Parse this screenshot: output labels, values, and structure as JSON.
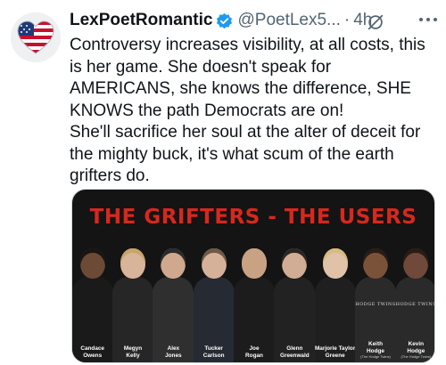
{
  "tweet": {
    "display_name": "LexPoetRomantic",
    "handle": "@PoetLex5...",
    "separator": "·",
    "time": "4h",
    "text": "Controversy increases visibility, at all costs, this is her game. She doesn't speak for AMERICANS, she knows the difference, SHE KNOWS the path Democrats are on!\nShe'll sacrifice her soul at the alter of deceit for the mighty buck, it's what scum of the earth grifters do."
  },
  "icons": {
    "verified": "verified-badge-icon",
    "grok": "grok-icon",
    "more": "more-options-icon",
    "avatar": "heart-flag-avatar"
  },
  "colors": {
    "verified_blue": "#1d9bf0",
    "text": "#0f1419",
    "secondary": "#536471",
    "title_red": "#d6281e",
    "media_bg": "#141414"
  },
  "media": {
    "title": "THE GRIFTERS - THE USERS",
    "people": [
      {
        "name": "Candace\nOwens",
        "sub": ""
      },
      {
        "name": "Megyn\nKelly",
        "sub": ""
      },
      {
        "name": "Alex\nJones",
        "sub": ""
      },
      {
        "name": "Tucker\nCarlson",
        "sub": ""
      },
      {
        "name": "Joe\nRogan",
        "sub": ""
      },
      {
        "name": "Glenn\nGreenwald",
        "sub": ""
      },
      {
        "name": "Marjorie Taylor\nGreene",
        "sub": ""
      },
      {
        "name": "Keith\nHodge",
        "sub": "(The Hodge Twins)"
      },
      {
        "name": "Kevin\nHodge",
        "sub": "(The Hodge Twins)"
      }
    ],
    "shirt_text": "HODGE TWINS"
  }
}
